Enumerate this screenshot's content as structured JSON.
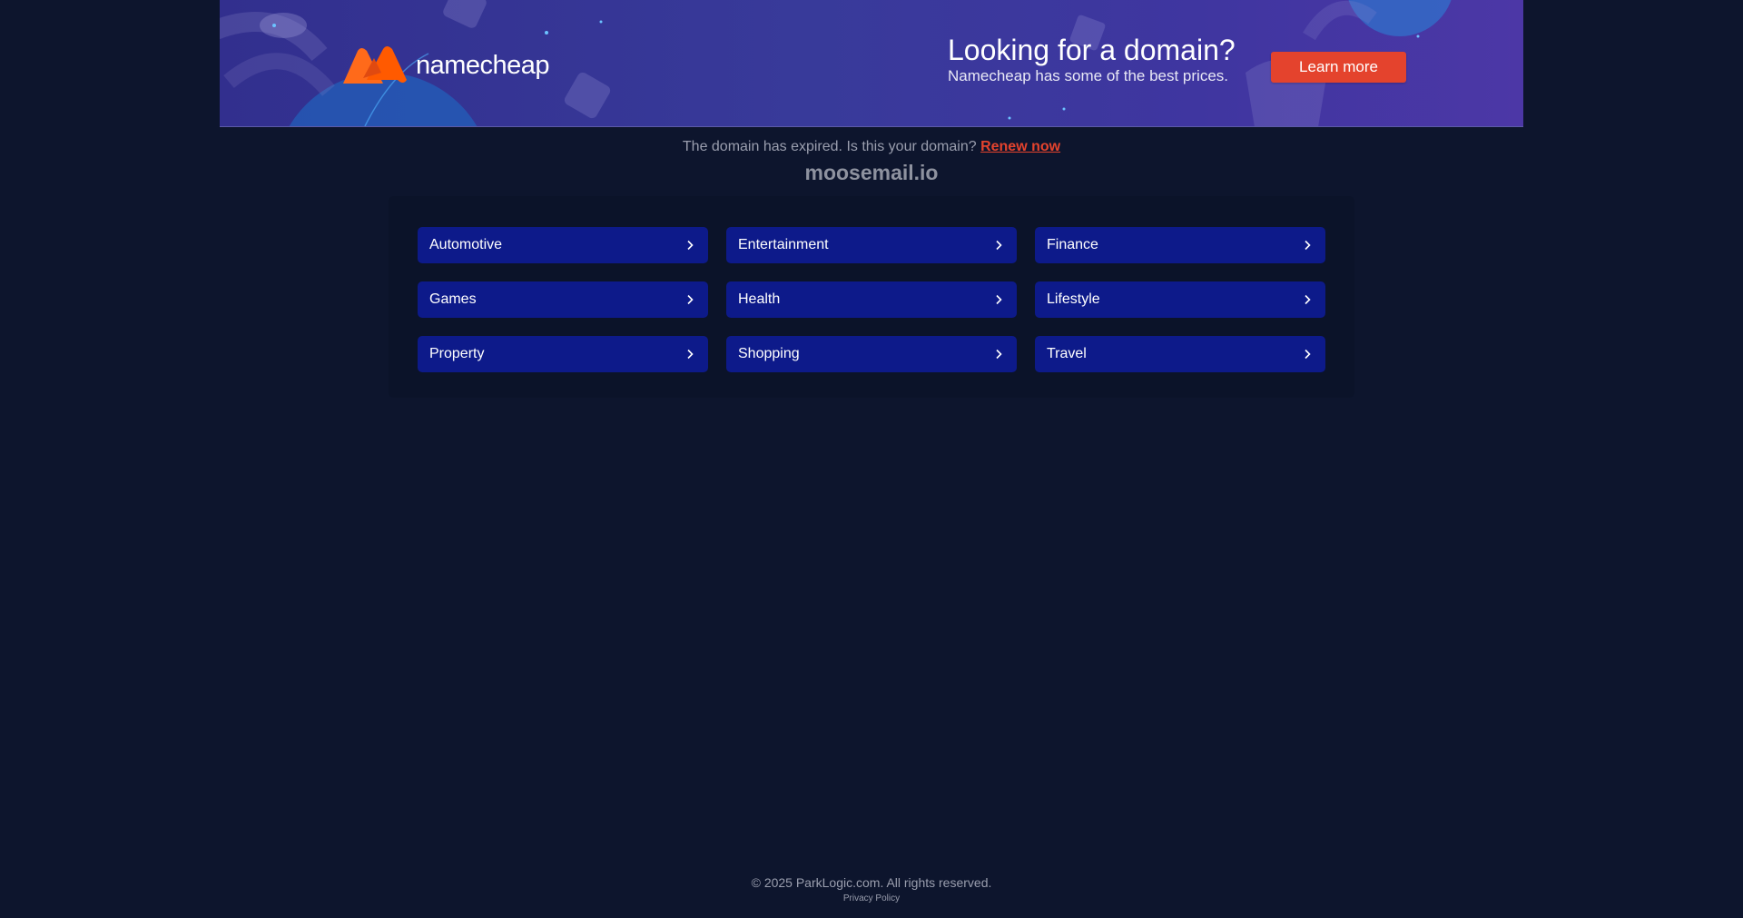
{
  "banner": {
    "logo_text": "namecheap",
    "title": "Looking for a domain?",
    "subtitle": "Namecheap has some of the best prices.",
    "button_label": "Learn more",
    "colors": {
      "background": "#383a9a",
      "button": "#e4432d",
      "logo_orange": "#ff6a1a"
    }
  },
  "notice": {
    "text": "The domain has expired. Is this your domain?",
    "renew_label": "Renew now"
  },
  "domain": "moosemail.io",
  "categories": [
    {
      "label": "Automotive"
    },
    {
      "label": "Entertainment"
    },
    {
      "label": "Finance"
    },
    {
      "label": "Games"
    },
    {
      "label": "Health"
    },
    {
      "label": "Lifestyle"
    },
    {
      "label": "Property"
    },
    {
      "label": "Shopping"
    },
    {
      "label": "Travel"
    }
  ],
  "category_icon": "chevron-right-icon",
  "footer": {
    "copyright": "© 2025 ParkLogic.com. All rights reserved.",
    "privacy_label": "Privacy Policy"
  },
  "colors": {
    "page_background": "#0d152d",
    "category_button": "#0d1a8a",
    "muted_text": "#9a9eae"
  }
}
